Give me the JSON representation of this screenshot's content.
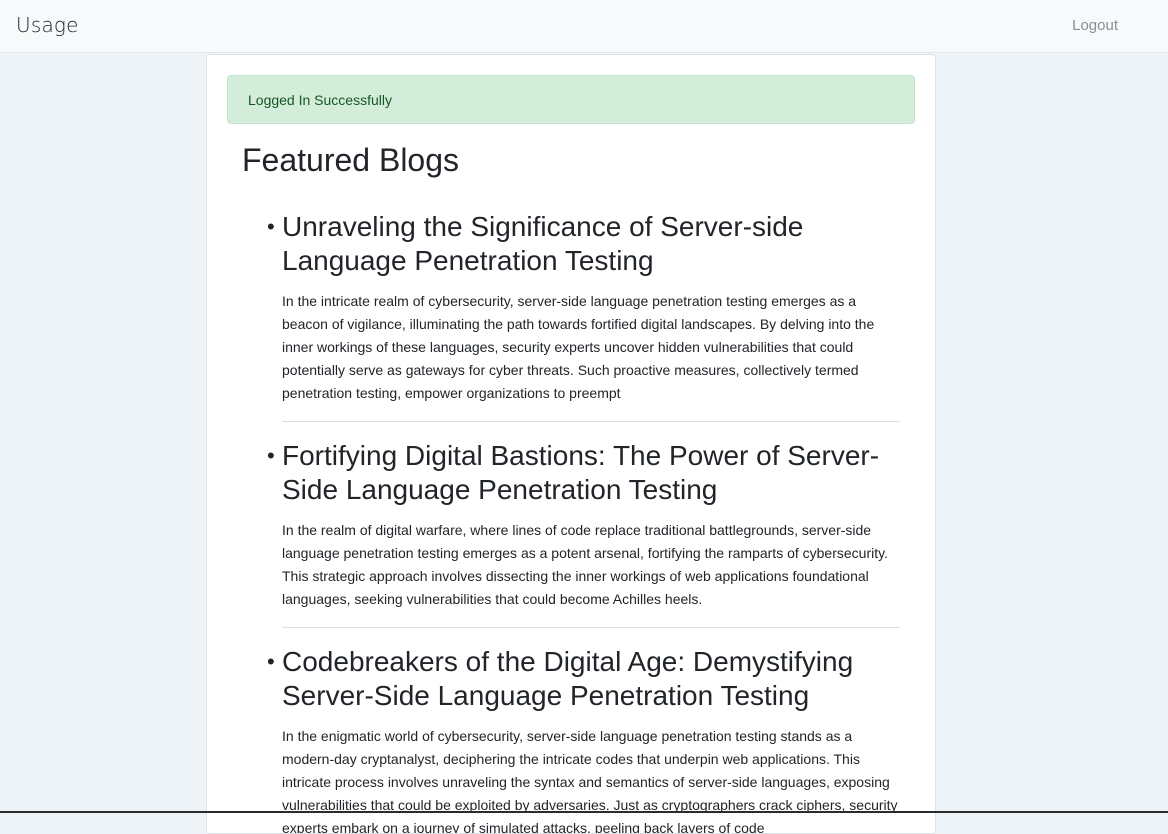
{
  "navbar": {
    "brand": "Usage",
    "logout_label": "Logout"
  },
  "alert": {
    "message": "Logged In Successfully"
  },
  "main": {
    "heading": "Featured Blogs",
    "blogs": [
      {
        "title": "Unraveling the Significance of Server-side Language Penetration Testing",
        "excerpt": "In the intricate realm of cybersecurity, server-side language penetration testing emerges as a beacon of vigilance, illuminating the path towards fortified digital landscapes. By delving into the inner workings of these languages, security experts uncover hidden vulnerabilities that could potentially serve as gateways for cyber threats. Such proactive measures, collectively termed penetration testing, empower organizations to preempt"
      },
      {
        "title": "Fortifying Digital Bastions: The Power of Server-Side Language Penetration Testing",
        "excerpt": "In the realm of digital warfare, where lines of code replace traditional battlegrounds, server-side language penetration testing emerges as a potent arsenal, fortifying the ramparts of cybersecurity. This strategic approach involves dissecting the inner workings of web applications foundational languages, seeking vulnerabilities that could become Achilles heels."
      },
      {
        "title": "Codebreakers of the Digital Age: Demystifying Server-Side Language Penetration Testing",
        "excerpt": "In the enigmatic world of cybersecurity, server-side language penetration testing stands as a modern-day cryptanalyst, deciphering the intricate codes that underpin web applications. This intricate process involves unraveling the syntax and semantics of server-side languages, exposing vulnerabilities that could be exploited by adversaries. Just as cryptographers crack ciphers, security experts embark on a journey of simulated attacks, peeling back layers of code"
      }
    ]
  }
}
